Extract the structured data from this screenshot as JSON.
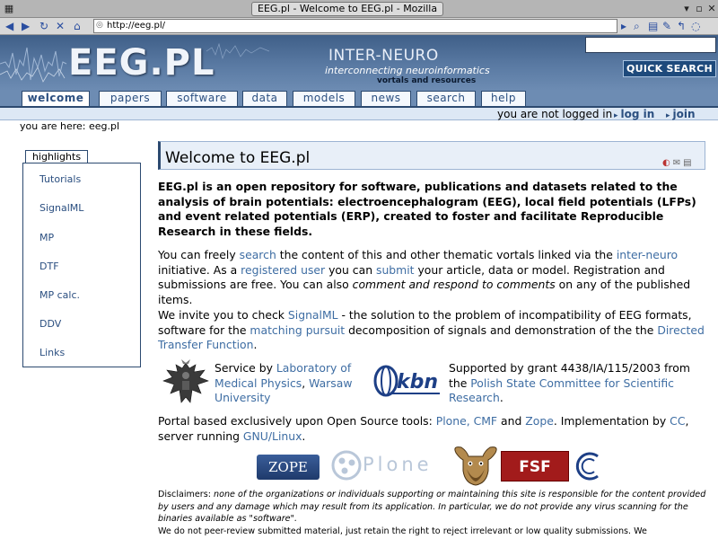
{
  "window": {
    "title": "EEG.pl - Welcome to EEG.pl - Mozilla"
  },
  "navbar": {
    "url": "http://eeg.pl/"
  },
  "header": {
    "logo": "EEG.PL",
    "brand_title": "INTER-NEURO",
    "brand_subtitle": "interconnecting neuroinformatics",
    "brand_subtitle2": "vortals and resources",
    "search_value": "",
    "quick_search_label": "QUICK SEARCH"
  },
  "tabs": [
    {
      "label": "welcome"
    },
    {
      "label": "papers"
    },
    {
      "label": "software"
    },
    {
      "label": "data"
    },
    {
      "label": "models"
    },
    {
      "label": "news"
    },
    {
      "label": "search"
    },
    {
      "label": "help"
    }
  ],
  "login": {
    "status": "you are not logged in",
    "login_label": "log in",
    "join_label": "join"
  },
  "breadcrumb": "you are here: eeg.pl",
  "sidebar": {
    "title": "highlights",
    "items": [
      {
        "label": "Tutorials"
      },
      {
        "label": "SignalML"
      },
      {
        "label": "MP"
      },
      {
        "label": "DTF"
      },
      {
        "label": "MP calc."
      },
      {
        "label": "DDV"
      },
      {
        "label": "Links"
      }
    ]
  },
  "main": {
    "title": "Welcome to EEG.pl",
    "intro": "EEG.pl is an open repository for software, publications and datasets related to the analysis of brain potentials: electroencephalogram (EEG), local field potentials (LFPs) and event related potentials (ERP), created to foster and facilitate Reproducible Research in these fields.",
    "p1": {
      "t1": "You can freely ",
      "l1": "search",
      "t2": " the content of this and other thematic vortals linked via the ",
      "l2": "inter-neuro",
      "t3": " initiative. As a ",
      "l3": "registered user",
      "t4": " you can ",
      "l4": "submit",
      "t5": " your article, data or model. Registration and submissions are free. You can also ",
      "i1": "comment and respond to comments",
      "t6": " on any of the published items."
    },
    "p2": {
      "t1": "We invite you to check ",
      "l1": "SignalML",
      "t2": " - the solution to the problem of incompatibility of EEG formats, software for the ",
      "l2": "matching pursuit",
      "t3": " decomposition of signals and demonstration of the the ",
      "l3": "Directed Transfer Function",
      "t4": "."
    },
    "service": {
      "t1": "Service by ",
      "l1": "Laboratory of Medical Physics",
      "t2": ", ",
      "l2": "Warsaw University"
    },
    "support": {
      "t1": "Supported by grant 4438/IA/115/2003 from the ",
      "l1": "Polish State Committee for Scientific Research",
      "t2": "."
    },
    "portal": {
      "t1": "Portal based exclusively upon Open Source tools: ",
      "l1": "Plone, CMF",
      "t2": " and ",
      "l2": "Zope",
      "t3": ". Implementation by ",
      "l3": "CC",
      "t4": ", server running ",
      "l4": "GNU/Linux",
      "t5": "."
    },
    "logos": {
      "zope": "ZOPE",
      "plone": "Plone",
      "fsf": "FSF",
      "kbn": "kbn"
    },
    "disclaimer": {
      "t1": "Disclaimers: ",
      "i1": "none of the organizations or individuals supporting or maintaining this site is responsible for the content provided by users and any damage which may result from its application. In particular, we do not provide any virus scanning for the binaries available as \"software\".",
      "t2": "We do not peer-review submitted material, just retain the right to reject irrelevant or low quality submissions. We"
    }
  }
}
